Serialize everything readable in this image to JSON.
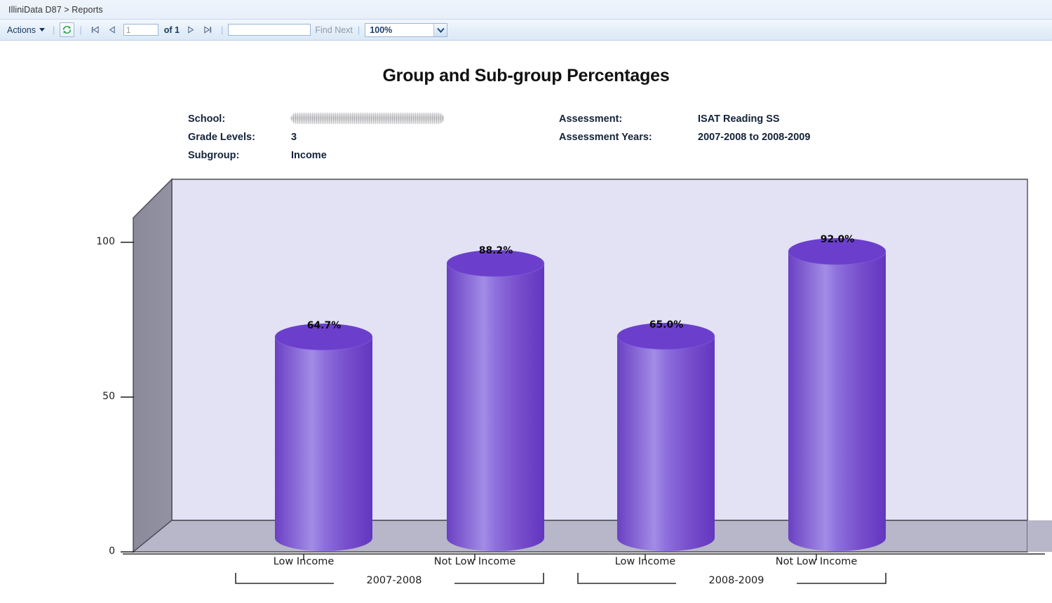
{
  "breadcrumb": {
    "text": "IlliniData D87 > Reports"
  },
  "toolbar": {
    "actions_label": "Actions",
    "refresh_icon": "refresh-icon",
    "first_page_icon": "first-page-icon",
    "prev_page_icon": "previous-page-icon",
    "next_page_icon": "next-page-icon",
    "last_page_icon": "last-page-icon",
    "page_value": "1",
    "page_placeholder": "1",
    "of_label": "of 1",
    "find_value": "",
    "find_placeholder": "",
    "find_next_label": "Find Next",
    "zoom_value": "100%",
    "zoom_options": [
      "100%"
    ],
    "zoom_caret_icon": "chevron-down-icon"
  },
  "report": {
    "title": "Group and Sub-group Percentages",
    "fields": [
      {
        "label": "School:",
        "value": ""
      },
      {
        "label": "Grade Levels:",
        "value": "3"
      },
      {
        "label": "Subgroup:",
        "value": "Income"
      },
      {
        "label": "Assessment:",
        "value": "ISAT Reading SS"
      },
      {
        "label": "Assessment Years:",
        "value": "2007-2008 to 2008-2009"
      }
    ]
  },
  "chart_data": {
    "type": "bar",
    "title": "Group and Sub-group Percentages",
    "xlabel": "",
    "ylabel": "",
    "ylim": [
      0,
      110
    ],
    "yticks": [
      0,
      50,
      100
    ],
    "ytick_labels": [
      "0",
      "50",
      "100"
    ],
    "grid": false,
    "legend": "none",
    "style": "3d-cylinder",
    "categories": [
      "Low Income",
      "Not Low Income",
      "Low Income",
      "Not Low Income"
    ],
    "groups": [
      {
        "name": "2007-2008",
        "categories": [
          "Low Income",
          "Not Low Income"
        ],
        "values": [
          64.7,
          88.2
        ]
      },
      {
        "name": "2008-2009",
        "categories": [
          "Low Income",
          "Not Low Income"
        ],
        "values": [
          65.0,
          92.0
        ]
      }
    ],
    "values": [
      64.7,
      88.2,
      65.0,
      92.0
    ],
    "value_labels": [
      "64.7%",
      "88.2%",
      "65.0%",
      "92.0%"
    ],
    "colors": {
      "bar": "#7b52cf",
      "bar_top": "#6f3fcb",
      "back_wall": "#e2e2f4",
      "floor": "#b7b7c9",
      "left_wall": "#8e8e9e",
      "outline": "#333333"
    }
  }
}
